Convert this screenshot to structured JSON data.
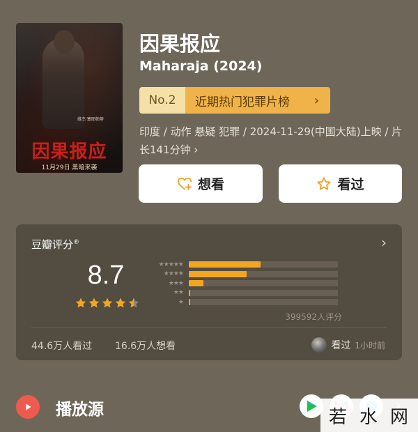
{
  "movie": {
    "title": "因果报应",
    "subtitle": "Maharaja (2024)",
    "poster": {
      "title_text": "因果报应",
      "credits_text": "维杰·塞图帕蒂",
      "date_text": "11月29日 黑暗来袭"
    },
    "rank": {
      "number": "No.2",
      "list_name": "近期热门犯罪片榜",
      "chevron": "›"
    },
    "meta_line": "印度 / 动作 悬疑 犯罪 / 2024-11-29(中国大陆)上映 / 片长141分钟 ›"
  },
  "actions": {
    "want_label": "想看",
    "seen_label": "看过"
  },
  "rating": {
    "header": "豆瓣评分",
    "header_mark": "®",
    "score": "8.7",
    "stars_value": 4.5,
    "distribution": [
      {
        "stars": "★★★★★",
        "fraction": 0.48
      },
      {
        "stars": "★★★★",
        "fraction": 0.39
      },
      {
        "stars": "★★★",
        "fraction": 0.1
      },
      {
        "stars": "★★",
        "fraction": 0.01
      },
      {
        "stars": "★",
        "fraction": 0.01
      }
    ],
    "votes": "399592人评分",
    "seen_count": "44.6万人看过",
    "want_count": "16.6万人想看",
    "recent_label": "看过",
    "recent_time": "1小时前"
  },
  "source": {
    "title": "播放源",
    "chevron": "›"
  },
  "watermark": {
    "chars": [
      "若",
      "水",
      "网"
    ]
  },
  "colors": {
    "background": "#6e6759",
    "accent_orange": "#f2a623",
    "rank_pill": "#f0b349",
    "source_icon": "#ee5b4e"
  }
}
